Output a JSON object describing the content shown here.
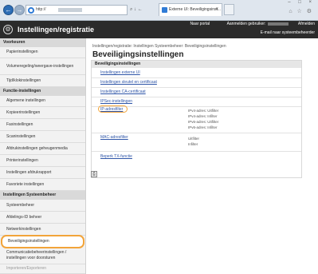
{
  "browser": {
    "address": "http://",
    "address_tools": "⌕ ↓ ←",
    "tab_title": "Externe UI: Beveiligingsinst...",
    "tab_close": "×",
    "win_controls": "– □ ×",
    "toolbar_icons": "⌂ ☆ ⚙"
  },
  "header": {
    "app_title": "Instellingen/registratie",
    "portal_link": "Naar portal",
    "login_label": "Aanmelden gebruiker:",
    "logout_link": "Afmelden",
    "mail_link": "E-mail naar systeembeheerder"
  },
  "sidebar": {
    "sections": [
      {
        "title": "Voorkeuren",
        "items": [
          {
            "label": "Papierinstellingen"
          },
          {
            "label": "Volumeregeling/weergave-instellingen"
          },
          {
            "label": "Tijd/klokinstellingen"
          }
        ]
      },
      {
        "title": "Functie-instellingen",
        "items": [
          {
            "label": "Algemene instellingen"
          },
          {
            "label": "Kopieerinstellingen"
          },
          {
            "label": "Faxinstellingen"
          },
          {
            "label": "Scaninstellingen"
          },
          {
            "label": "Afdrukinstellingen geheugenmedia"
          },
          {
            "label": "Printerinstellingen"
          },
          {
            "label": "Instellingen afdrukrapport"
          },
          {
            "label": "Favoriete instellingen"
          }
        ]
      },
      {
        "title": "Instellingen Systeembeheer",
        "items": [
          {
            "label": "Systeembeheer"
          },
          {
            "label": "Afdelings-ID beheer"
          },
          {
            "label": "Netwerkinstellingen"
          },
          {
            "label": "Beveiligingsinstellingen"
          },
          {
            "label": "Communicatiebeheerinstellingen / instellingen voor doorsturen"
          },
          {
            "label": "Importeren/Exporteren"
          }
        ]
      }
    ]
  },
  "main": {
    "breadcrumb": "Instellingen/registratie: Instellingen Systeembeheer: Beveiligingsinstellingen",
    "page_title": "Beveiligingsinstellingen",
    "panel_title": "Beveiligingsinstellingen",
    "links": [
      "Instellingen externe UI",
      "Instellingen sleutel en certificaat",
      "Instellingen CA-certificaat",
      "IPSec-instellingen",
      "IP-adresfilter",
      "MAC-adresfilter",
      "Beperk TX-functie"
    ],
    "ip_values": [
      "IPv4-adres: Uitfilter",
      "IPv4-adres: Infilter",
      "IPv6-adres: Uitfilter",
      "IPv6-adres: Infilter"
    ],
    "mac_values": [
      "Uitfilter",
      "Infilter"
    ]
  }
}
